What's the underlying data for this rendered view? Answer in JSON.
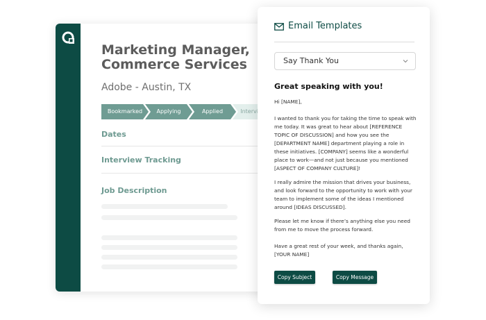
{
  "job": {
    "title": "Marketing Manager, Commerce Services",
    "company": "Adobe - Austin, TX",
    "stages": [
      {
        "label": "Bookmarked",
        "state": "active"
      },
      {
        "label": "Applying",
        "state": "active"
      },
      {
        "label": "Applied",
        "state": "active"
      },
      {
        "label": "Interviewing",
        "state": "inactive"
      }
    ],
    "sections": {
      "dates": "Dates",
      "interview_tracking": "Interview Tracking",
      "job_description": "Job Description"
    }
  },
  "email": {
    "panel_title": "Email Templates",
    "selected_template": "Say Thank You",
    "subject": "Great speaking with you!",
    "body": {
      "greeting": "Hi [NAME],",
      "p1": "I wanted to thank you for taking the time to speak with me today. It was great to hear about [REFERENCE TOPIC OF DISCUSSION] and how you see the [DEPARTMENT NAME] department playing a role in these initiatives. [COMPANY] seems like a wonderful place to work—and not just because you mentioned [ASPECT OF COMPANY CULTURE]!",
      "p2": "I really admire the mission that drives your business, and look forward to the opportunity to work with your team to implement some of the ideas I mentioned around [IDEAS DISCUSSED].",
      "p3": "Please let me know if there’s anything else you need from me to move the process forward.",
      "p4": "Have a great rest of your week, and thanks again, [YOUR NAME]"
    },
    "buttons": {
      "copy_subject": "Copy Subject",
      "copy_message": "Copy Message"
    }
  },
  "colors": {
    "brand_dark": "#0d4b44",
    "stage_active": "#6f9c93",
    "stage_inactive": "#e3efec",
    "section_text": "#6e9a91"
  },
  "icons": {
    "logo": "app-logo-icon",
    "mail": "mail-icon",
    "dropdown": "chevron-down-icon"
  }
}
